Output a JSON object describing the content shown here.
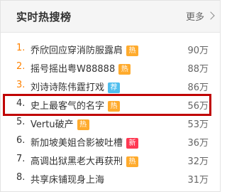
{
  "header": {
    "title": "实时热搜榜",
    "more_label": "更多"
  },
  "items": [
    {
      "rank": "1.",
      "title": "乔欣回应穿消防服露肩",
      "badge": "热",
      "badge_color": "#ffab2d",
      "count": "90万"
    },
    {
      "rank": "2.",
      "title": "摇号摇出粤W88888",
      "badge": "热",
      "badge_color": "#ffab2d",
      "count": "88万"
    },
    {
      "rank": "3.",
      "title": "刘诗诗陈伟霆打戏",
      "badge": "荐",
      "badge_color": "#4fbeee",
      "count": "86万"
    },
    {
      "rank": "4.",
      "title": "史上最客气的名字",
      "badge": "热",
      "badge_color": "#ffab2d",
      "count": "56万"
    },
    {
      "rank": "5.",
      "title": "Vertu破产",
      "badge": "热",
      "badge_color": "#ffab2d",
      "count": "53万"
    },
    {
      "rank": "6.",
      "title": "新加坡美姐合影被吐槽",
      "badge": "新",
      "badge_color": "#ff3852",
      "count": "36万"
    },
    {
      "rank": "7.",
      "title": "高调出狱黑老大再获刑",
      "badge": "热",
      "badge_color": "#ffab2d",
      "count": "32万"
    },
    {
      "rank": "8.",
      "title": "共享床铺现身上海",
      "badge": "",
      "badge_color": "",
      "count": "31万"
    }
  ],
  "colors": {
    "rank_hot": "#ff8200",
    "highlight_border": "#c00000"
  }
}
